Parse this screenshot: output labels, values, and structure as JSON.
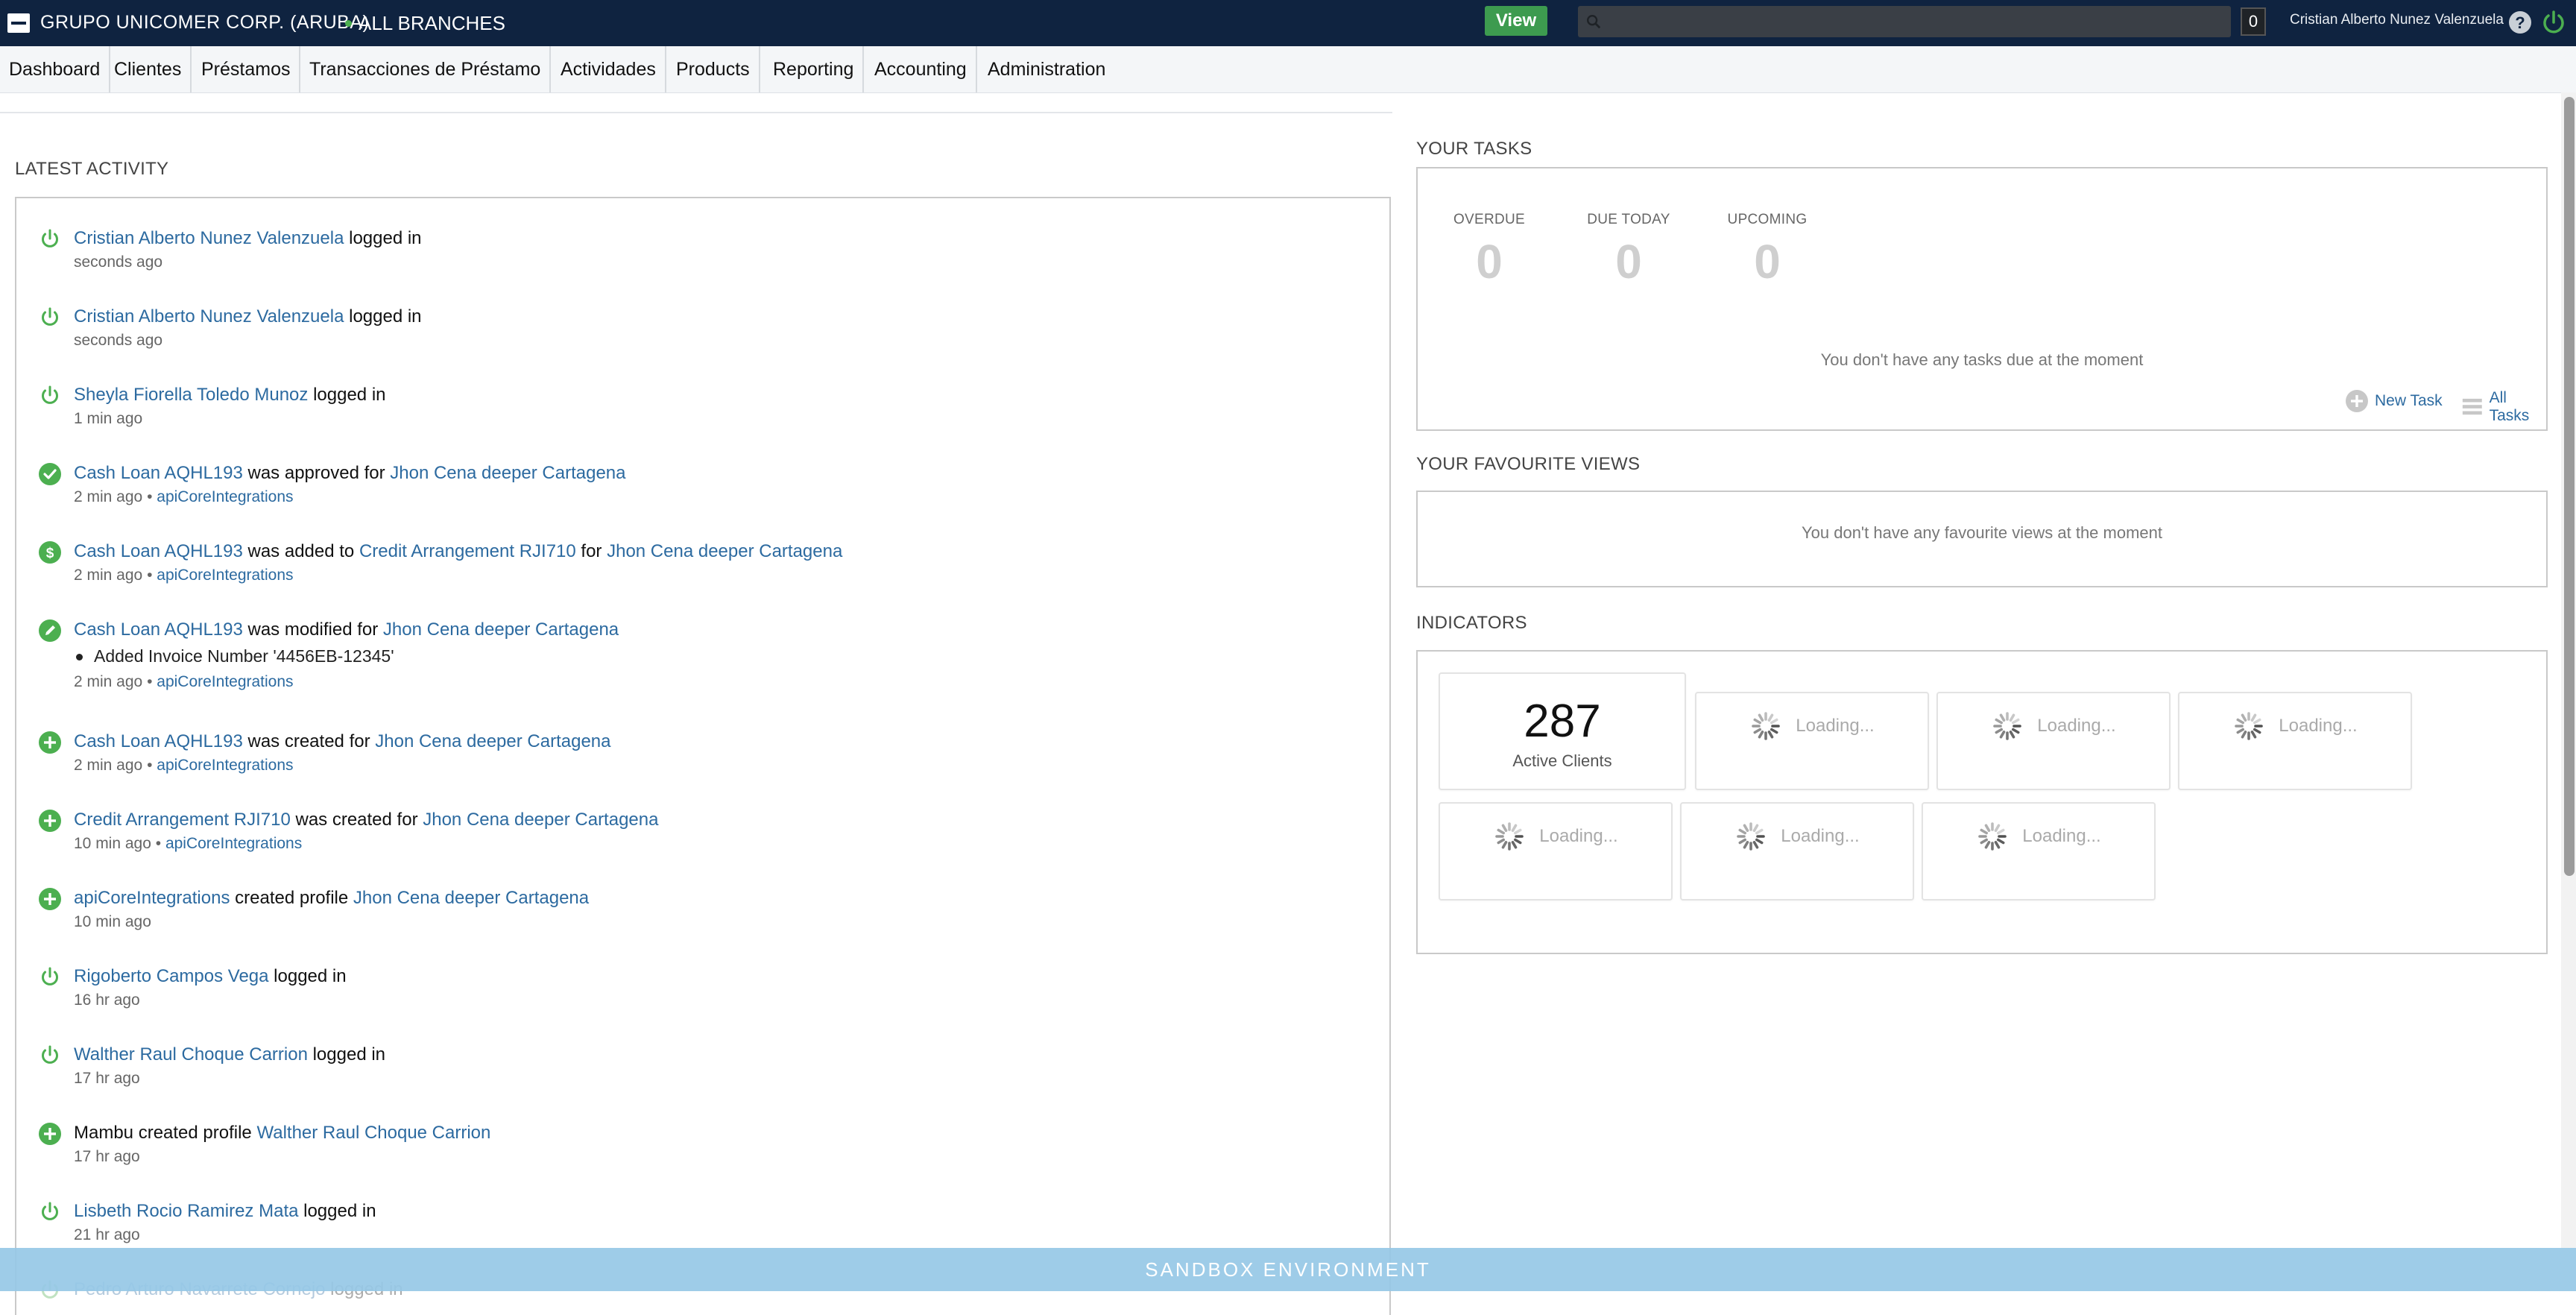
{
  "header": {
    "org_name": "GRUPO UNICOMER CORP. (ARUBA)",
    "branch": "ALL BRANCHES",
    "view_label": "View",
    "search_placeholder": "",
    "notification_count": "0",
    "user_name": "Cristian Alberto Nunez Valenzuela",
    "colors": {
      "topbar": "#0f2340",
      "view_button": "#3d9b4f",
      "accent_link": "#2c6aa0"
    }
  },
  "nav": {
    "items": [
      "Dashboard",
      "Clientes",
      "Préstamos",
      "Transacciones de Préstamo",
      "Actividades",
      "Products",
      "Reporting",
      "Accounting",
      "Administration"
    ]
  },
  "activity": {
    "title": "LATEST ACTIVITY",
    "items": [
      {
        "icon": "power-icon",
        "parts": [
          {
            "t": "Cristian Alberto Nunez Valenzuela",
            "link": true
          },
          {
            "t": " logged in"
          }
        ],
        "time": "seconds ago",
        "by": ""
      },
      {
        "icon": "power-icon",
        "parts": [
          {
            "t": "Cristian Alberto Nunez Valenzuela",
            "link": true
          },
          {
            "t": " logged in"
          }
        ],
        "time": "seconds ago",
        "by": ""
      },
      {
        "icon": "power-icon",
        "parts": [
          {
            "t": "Sheyla Fiorella Toledo Munoz",
            "link": true
          },
          {
            "t": " logged in"
          }
        ],
        "time": "1 min ago",
        "by": ""
      },
      {
        "icon": "check-icon",
        "parts": [
          {
            "t": "Cash Loan AQHL193",
            "link": true
          },
          {
            "t": " was approved for "
          },
          {
            "t": "Jhon Cena deeper Cartagena",
            "link": true
          }
        ],
        "time": "2 min ago",
        "by": "apiCoreIntegrations"
      },
      {
        "icon": "dollar-icon",
        "parts": [
          {
            "t": "Cash Loan AQHL193",
            "link": true
          },
          {
            "t": " was added to "
          },
          {
            "t": "Credit Arrangement RJI710",
            "link": true
          },
          {
            "t": " for "
          },
          {
            "t": "Jhon Cena deeper Cartagena",
            "link": true
          }
        ],
        "time": "2 min ago",
        "by": "apiCoreIntegrations"
      },
      {
        "icon": "edit-icon",
        "parts": [
          {
            "t": "Cash Loan AQHL193",
            "link": true
          },
          {
            "t": " was modified for "
          },
          {
            "t": "Jhon Cena deeper Cartagena",
            "link": true
          }
        ],
        "detail": "Added Invoice Number '4456EB-12345'",
        "time": "2 min ago",
        "by": "apiCoreIntegrations"
      },
      {
        "icon": "plus-icon",
        "parts": [
          {
            "t": "Cash Loan AQHL193",
            "link": true
          },
          {
            "t": " was created for "
          },
          {
            "t": "Jhon Cena deeper Cartagena",
            "link": true
          }
        ],
        "time": "2 min ago",
        "by": "apiCoreIntegrations"
      },
      {
        "icon": "plus-icon",
        "parts": [
          {
            "t": "Credit Arrangement RJI710",
            "link": true
          },
          {
            "t": " was created for "
          },
          {
            "t": "Jhon Cena deeper Cartagena",
            "link": true
          }
        ],
        "time": "10 min ago",
        "by": "apiCoreIntegrations"
      },
      {
        "icon": "plus-icon",
        "parts": [
          {
            "t": "apiCoreIntegrations",
            "link": true
          },
          {
            "t": " created profile "
          },
          {
            "t": "Jhon Cena deeper Cartagena",
            "link": true
          }
        ],
        "time": "10 min ago",
        "by": ""
      },
      {
        "icon": "power-icon",
        "parts": [
          {
            "t": "Rigoberto Campos Vega",
            "link": true
          },
          {
            "t": " logged in"
          }
        ],
        "time": "16 hr ago",
        "by": ""
      },
      {
        "icon": "power-icon",
        "parts": [
          {
            "t": "Walther Raul Choque Carrion",
            "link": true
          },
          {
            "t": " logged in"
          }
        ],
        "time": "17 hr ago",
        "by": ""
      },
      {
        "icon": "plus-icon",
        "parts": [
          {
            "t": "Mambu created profile "
          },
          {
            "t": "Walther Raul Choque Carrion",
            "link": true
          }
        ],
        "time": "17 hr ago",
        "by": ""
      },
      {
        "icon": "power-icon",
        "parts": [
          {
            "t": "Lisbeth Rocio Ramirez Mata",
            "link": true
          },
          {
            "t": " logged in"
          }
        ],
        "time": "21 hr ago",
        "by": ""
      },
      {
        "icon": "power-icon",
        "parts": [
          {
            "t": "Pedro Arturo Navarrete Cornejo",
            "link": true
          },
          {
            "t": " logged in"
          }
        ],
        "time": "",
        "by": ""
      }
    ]
  },
  "tasks": {
    "title": "YOUR TASKS",
    "columns": [
      {
        "label": "OVERDUE",
        "value": "0"
      },
      {
        "label": "DUE TODAY",
        "value": "0"
      },
      {
        "label": "UPCOMING",
        "value": "0"
      }
    ],
    "empty_message": "You don't have any tasks due at the moment",
    "new_task_label": "New Task",
    "all_tasks_label": "All Tasks"
  },
  "favourites": {
    "title": "YOUR FAVOURITE VIEWS",
    "empty_message": "You don't have any favourite views at the moment"
  },
  "indicators": {
    "title": "INDICATORS",
    "active_clients_value": "287",
    "active_clients_label": "Active Clients",
    "loading_label": "Loading..."
  },
  "footer": {
    "sandbox_label": "SANDBOX ENVIRONMENT"
  }
}
